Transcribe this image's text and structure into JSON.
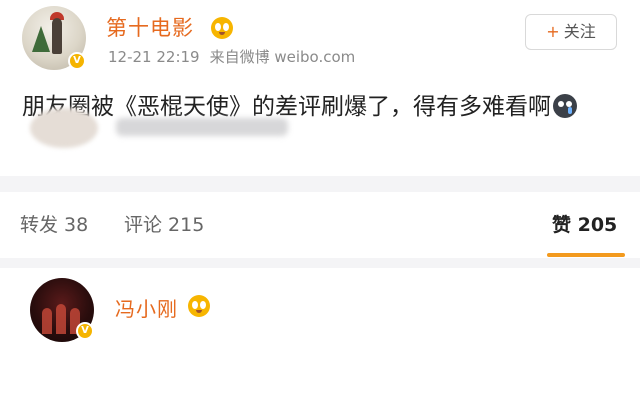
{
  "post": {
    "username": "第十电影",
    "time": "12-21 22:19",
    "source": "来自微博 weibo.com",
    "follow_label": "关注",
    "follow_icon": "+",
    "content": "朋友圈被《恶棍天使》的差评刷爆了，得有多难看啊"
  },
  "stats": {
    "repost_label": "转发 38",
    "comment_label": "评论 215",
    "like_label": "赞 205"
  },
  "comment": {
    "username": "冯小刚"
  },
  "colors": {
    "accent": "#e66a1f",
    "underline": "#f39a1e",
    "badge": "#f5b400"
  }
}
